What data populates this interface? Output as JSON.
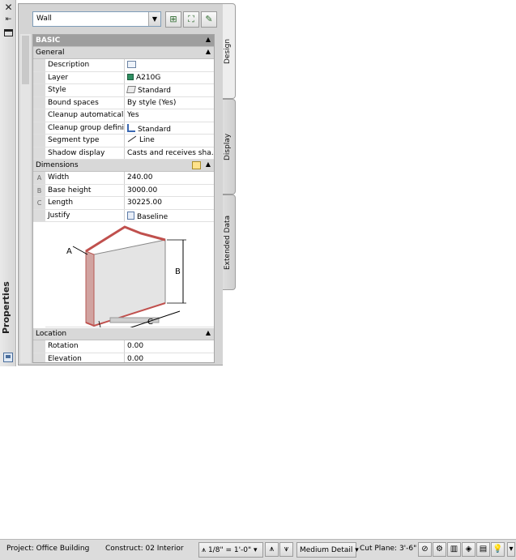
{
  "palette": {
    "title": "Properties",
    "type_select": {
      "value": "Wall"
    },
    "tabs": [
      {
        "label": "Design",
        "active": true
      },
      {
        "label": "Display",
        "active": false
      },
      {
        "label": "Extended Data",
        "active": false
      }
    ],
    "basic_section": "BASIC",
    "general": {
      "header": "General",
      "rows": [
        {
          "label": "Description",
          "value": "",
          "icon": "description-icon"
        },
        {
          "label": "Layer",
          "value": "A210G",
          "icon": "layer-color-icon"
        },
        {
          "label": "Style",
          "value": "Standard",
          "icon": "wall-style-icon"
        },
        {
          "label": "Bound spaces",
          "value": "By style (Yes)"
        },
        {
          "label": "Cleanup automatically",
          "value": "Yes"
        },
        {
          "label": "Cleanup group defini...",
          "value": "Standard",
          "icon": "cleanup-group-icon"
        },
        {
          "label": "Segment type",
          "value": "Line",
          "icon": "line-segment-icon"
        },
        {
          "label": "Shadow display",
          "value": "Casts and receives sha..."
        }
      ]
    },
    "dimensions": {
      "header": "Dimensions",
      "rows": [
        {
          "key": "A",
          "label": "Width",
          "value": "240.00"
        },
        {
          "key": "B",
          "label": "Base height",
          "value": "3000.00"
        },
        {
          "key": "C",
          "label": "Length",
          "value": "30225.00"
        },
        {
          "key": "",
          "label": "Justify",
          "value": "Baseline",
          "icon": "justify-icon"
        }
      ],
      "diagram_labels": {
        "a": "A",
        "b": "B",
        "c": "C"
      }
    },
    "location": {
      "header": "Location",
      "rows": [
        {
          "label": "Rotation",
          "value": "0.00"
        },
        {
          "label": "Elevation",
          "value": "0.00"
        }
      ]
    }
  },
  "statusbar": {
    "project": "Project: Office Building",
    "construct": "Construct: 02 Interior",
    "scale": "1/8\" = 1'-0\"",
    "detail": "Medium Detail",
    "cut_plane": "Cut Plane: 3'-6\""
  },
  "colors": {
    "section_basic": "#9e9e9e",
    "layer_swatch": "#2f8f62",
    "wall_edge": "#c0504d"
  }
}
